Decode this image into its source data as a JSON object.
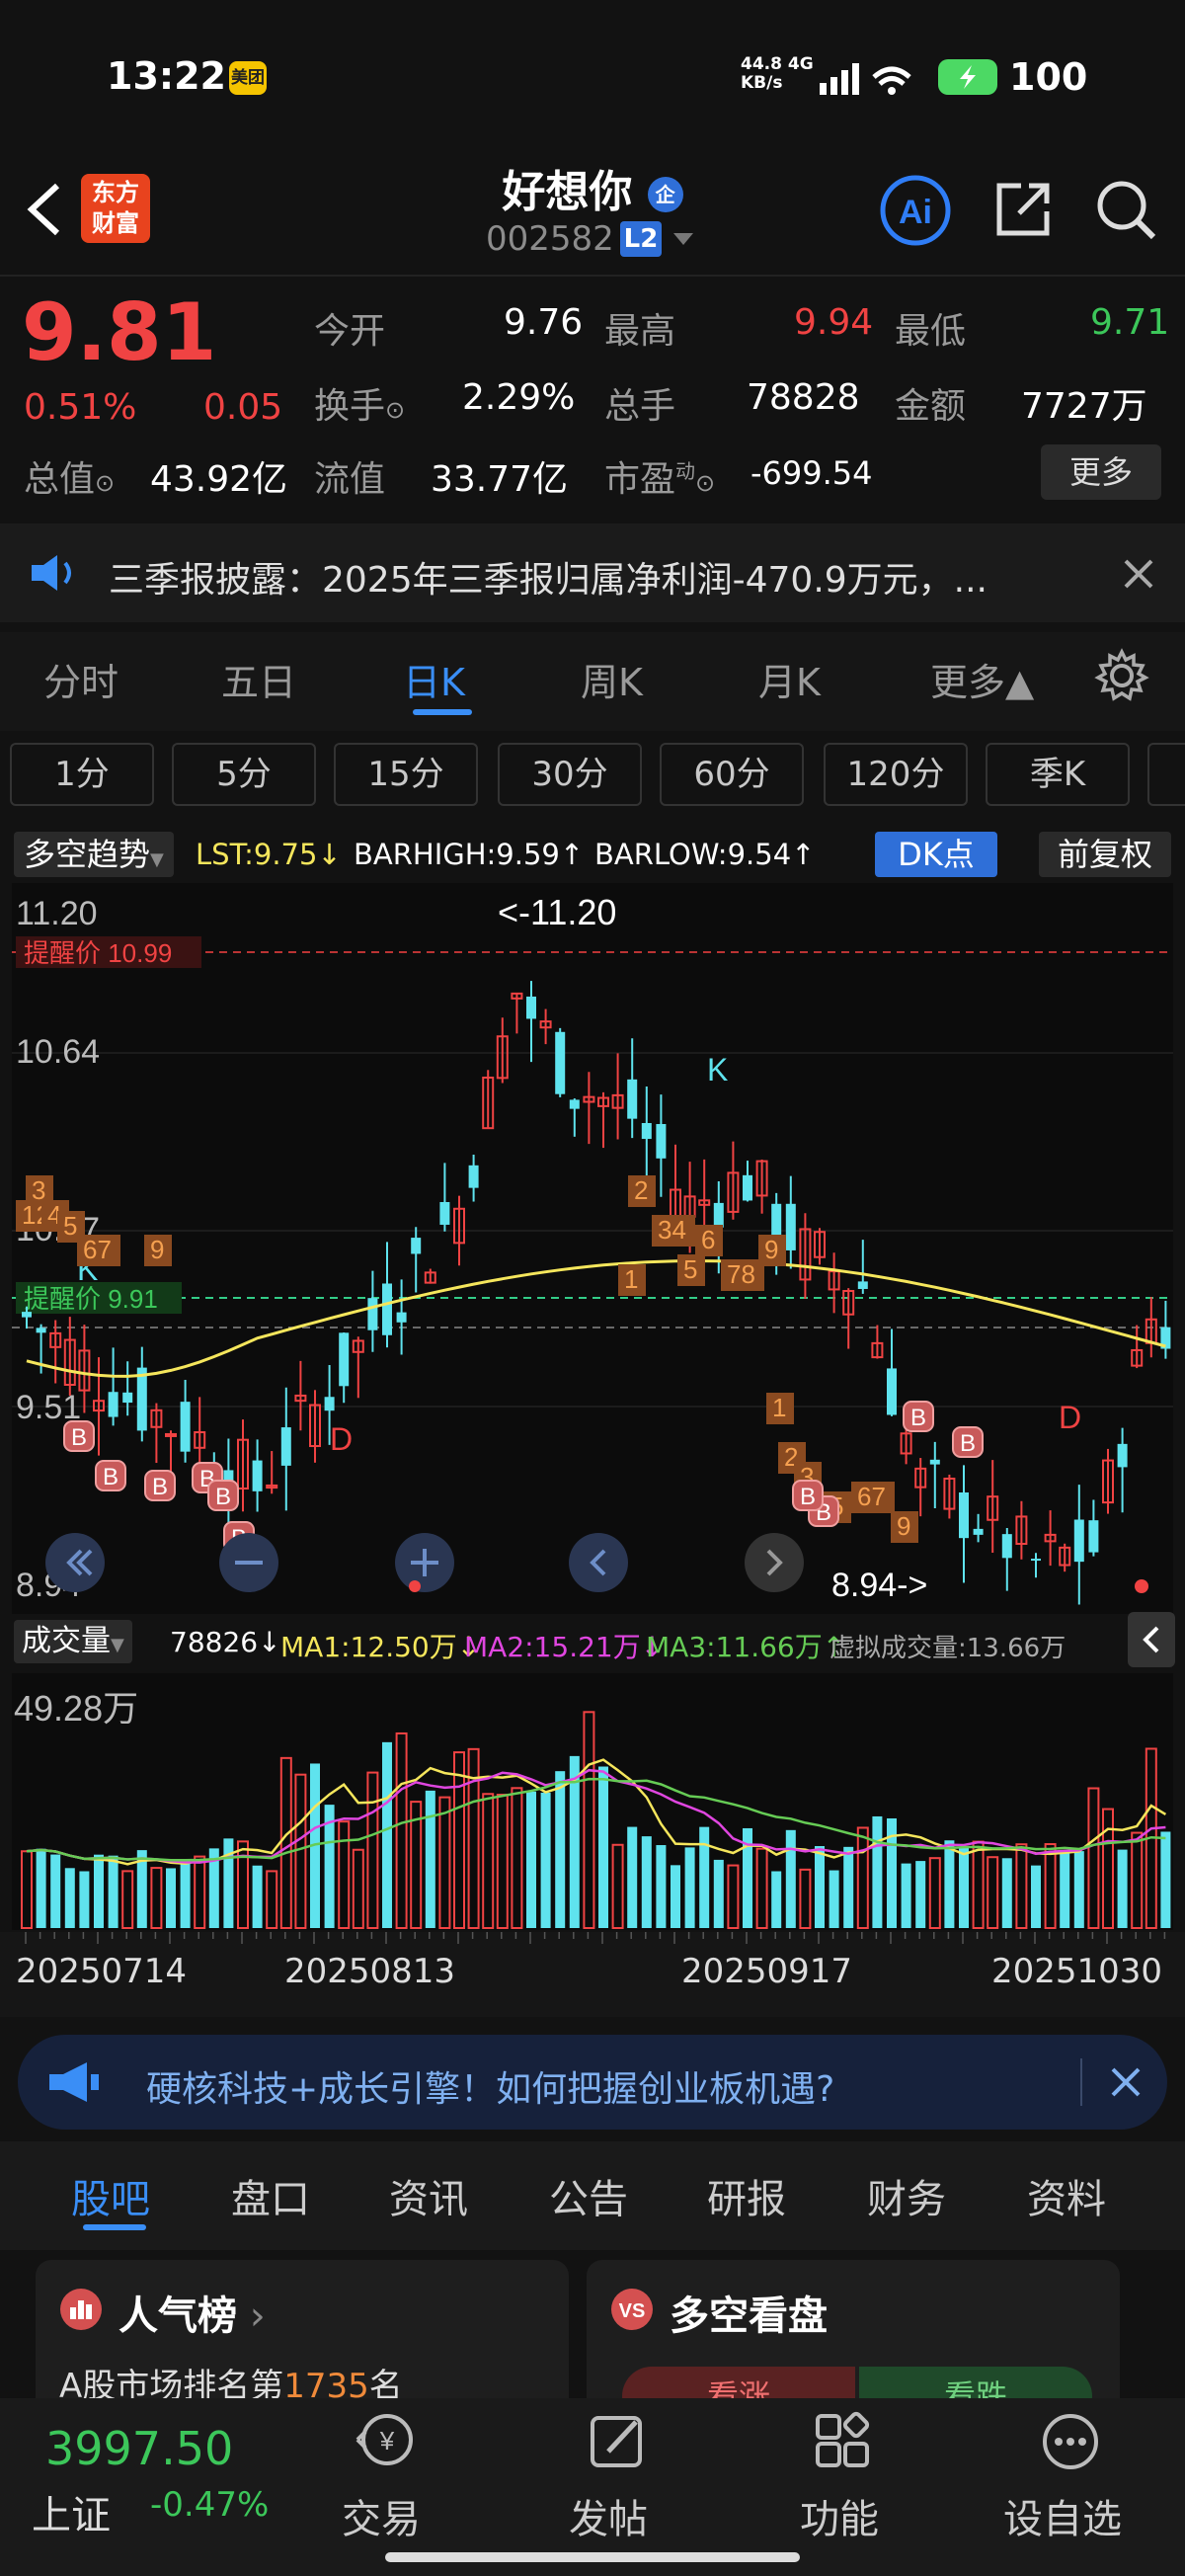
{
  "status": {
    "time": "13:22",
    "app_badge": "美团",
    "net_speed": "44.8",
    "net_unit": "KB/s",
    "net_type": "4G",
    "battery": "100"
  },
  "header": {
    "logo_line1": "东方",
    "logo_line2": "财富",
    "title": "好想你",
    "badge": "企",
    "code": "002582",
    "level": "L2"
  },
  "quote": {
    "price": "9.81",
    "pct": "0.51%",
    "chg": "0.05",
    "open_label": "今开",
    "open": "9.76",
    "high_label": "最高",
    "high": "9.94",
    "low_label": "最低",
    "low": "9.71",
    "turnover_label": "换手",
    "turnover": "2.29%",
    "vol_label": "总手",
    "vol": "78828",
    "amount_label": "金额",
    "amount": "7727万",
    "mktcap_label": "总值",
    "mktcap": "43.92亿",
    "float_label": "流值",
    "float": "33.77亿",
    "pe_label": "市盈",
    "pe_sup": "动",
    "pe": "-699.54",
    "more": "更多"
  },
  "notice": {
    "text": "三季报披露：2025年三季报归属净利润-470.9万元，..."
  },
  "tabs": [
    "分时",
    "五日",
    "日K",
    "周K",
    "月K",
    "更多▲"
  ],
  "active_tab": 2,
  "periods": [
    "1分",
    "5分",
    "15分",
    "30分",
    "60分",
    "120分",
    "季K"
  ],
  "indicator": {
    "name": "多空趋势",
    "lst": "LST:9.75↓",
    "barhigh": "BARHIGH:9.59↑",
    "barlow": "BARLOW:9.54↑",
    "dk": "DK点",
    "adjust": "前复权"
  },
  "chart": {
    "y_labels": [
      "11.20",
      "10.64",
      "10.07",
      "9.51",
      "8.94"
    ],
    "alert_label": "提醒价 10.99",
    "alert_label2": "提醒价 9.91",
    "max_label": "<-11.20",
    "min_label": "8.94->",
    "k_label": "K",
    "d_label": "D"
  },
  "volume": {
    "name": "成交量",
    "value": "78826↓",
    "ma1": "MA1:12.50万↓",
    "ma2": "MA2:15.21万↓",
    "ma3": "MA3:11.66万↑",
    "virtual": "虚拟成交量:13.66万",
    "max": "49.28万"
  },
  "dates": [
    "20250714",
    "20250813",
    "20250917",
    "20251030"
  ],
  "ad": {
    "text": "硬核科技+成长引擎！如何把握创业板机遇?"
  },
  "section_tabs": [
    "股吧",
    "盘口",
    "资讯",
    "公告",
    "研报",
    "财务",
    "资料"
  ],
  "cards": {
    "left_title": "人气榜",
    "left_sub_prefix": "A股市场排名第",
    "left_rank": "1735",
    "left_sub_suffix": "名",
    "right_title": "多空看盘",
    "right_up": "看涨",
    "right_down": "看跌"
  },
  "bottom": {
    "index_value": "3997.50",
    "index_name": "上证",
    "index_chg": "-0.47%",
    "items": [
      "交易",
      "发帖",
      "功能",
      "设自选"
    ]
  },
  "colors": {
    "up": "#f04343",
    "down": "#5fe3ee",
    "accent": "#2f7df6",
    "ma1": "#f5e65c",
    "ma2": "#e046e0",
    "ma3": "#66cc55"
  }
}
